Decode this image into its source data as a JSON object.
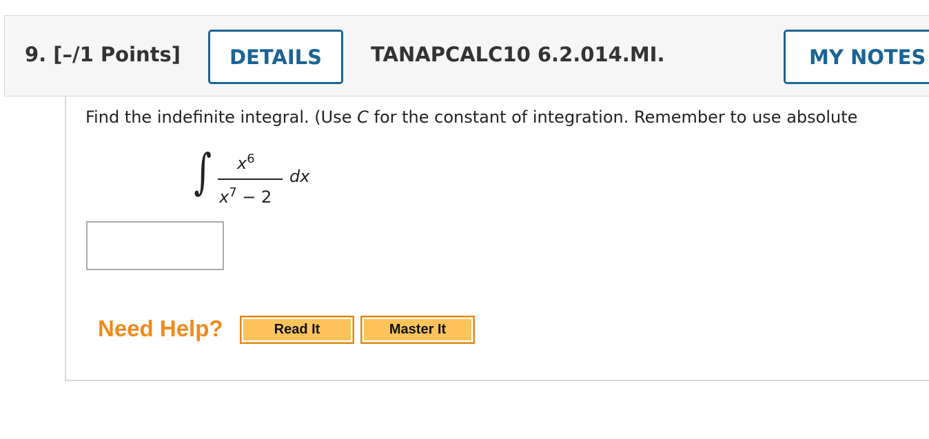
{
  "header": {
    "question_label": "9.  [–/1 Points]",
    "details_label": "DETAILS",
    "problem_id": "TANAPCALC10 6.2.014.MI.",
    "my_notes_label": "MY NOTES"
  },
  "question": {
    "text_before_var": "Find the indefinite integral. (Use ",
    "variable": "C",
    "text_after_var": " for the constant of integration. Remember to use absolute"
  },
  "integral": {
    "sign": "∫",
    "numerator_base": "x",
    "numerator_exp": "6",
    "denominator_base": "x",
    "denominator_exp": "7",
    "denominator_rest": " − 2",
    "differential": "dx"
  },
  "answer": {
    "value": ""
  },
  "help": {
    "label": "Need Help?",
    "read_it": "Read It",
    "master_it": "Master It"
  },
  "colors": {
    "accent_blue": "#1a6496",
    "help_orange": "#f08a1c",
    "button_fill": "#fbc35a"
  }
}
